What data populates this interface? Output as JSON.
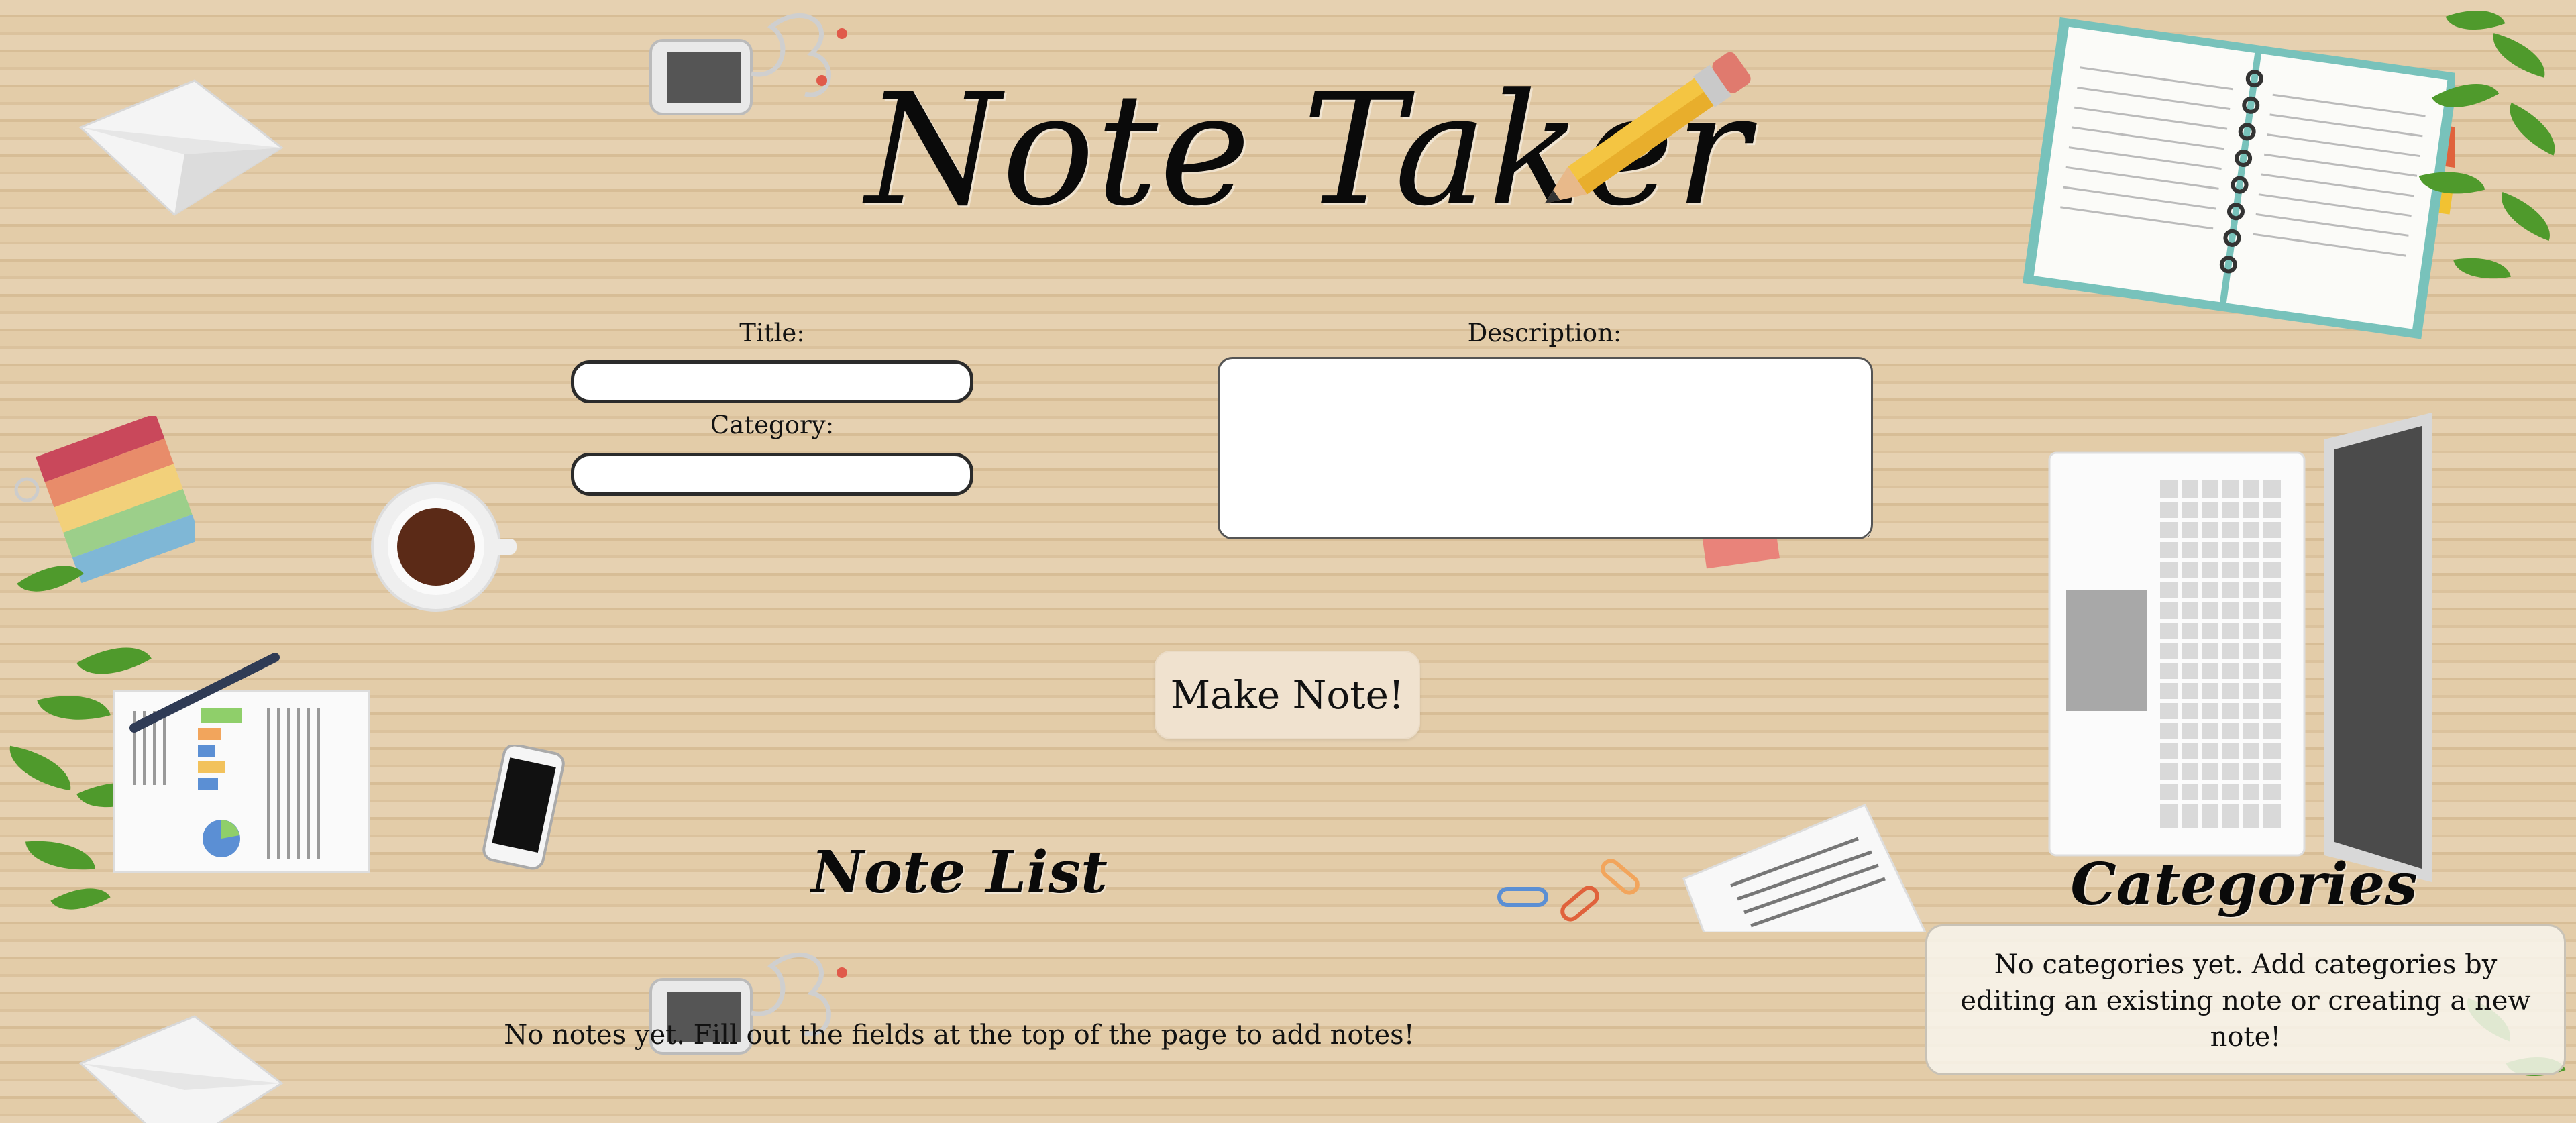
{
  "app": {
    "title": "Note Taker"
  },
  "form": {
    "title_label": "Title:",
    "title_value": "",
    "category_label": "Category:",
    "category_value": "",
    "description_label": "Description:",
    "description_value": "",
    "submit_label": "Make Note!"
  },
  "notes": {
    "heading": "Note List",
    "empty_message": "No notes yet. Fill out the fields at the top of the page to add notes!"
  },
  "categories": {
    "heading": "Categories",
    "empty_message": "No categories yet. Add categories by editing an existing note or creating a new note!"
  },
  "icons": {
    "title_decoration": "pencil-icon"
  }
}
